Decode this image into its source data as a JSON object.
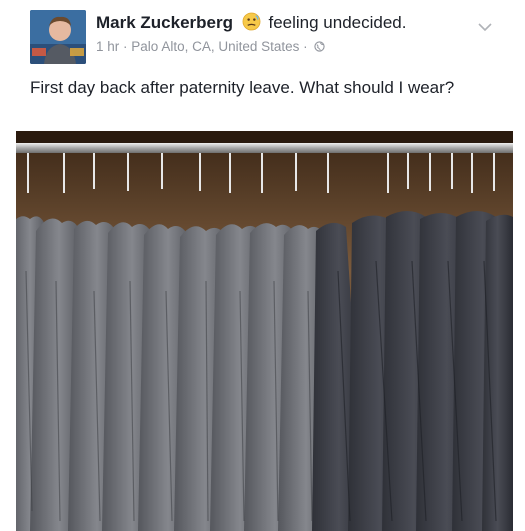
{
  "post": {
    "author": "Mark Zuckerberg",
    "feeling": "feeling undecided.",
    "feeling_icon": "undecided-face-emoji",
    "time": "1 hr",
    "separator": "·",
    "location": "Palo Alto, CA, United States",
    "privacy_icon": "globe-icon",
    "menu_icon": "chevron-down-icon",
    "text": "First day back after paternity leave. What should I wear?",
    "photo_subject": "closet-of-gray-tshirts"
  },
  "colors": {
    "name": "#1d2129",
    "meta": "#90949c",
    "emoji": "#f7c948",
    "shirt": "#6b6d72",
    "hoodie": "#3d3f47",
    "closet_back": "#5b3f27",
    "rail": "#c9c9c9"
  }
}
